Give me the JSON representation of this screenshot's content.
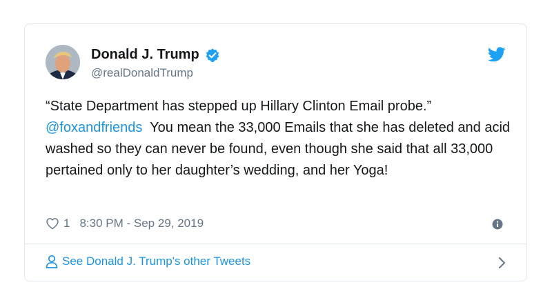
{
  "tweet": {
    "author_name": "Donald J. Trump",
    "handle": "@realDonaldTrump",
    "text_quote": "“State Department has stepped up Hillary Clinton Email probe.”",
    "mention": "@foxandfriends",
    "text_body": "You mean the 33,000 Emails that she has deleted and acid washed so they can never be found, even though she said that all 33,000 pertained only to her daughter’s wedding, and her Yoga!",
    "like_count": "1",
    "timestamp": "8:30 PM - Sep 29, 2019"
  },
  "footer": {
    "link_text": "See Donald J. Trump's other Tweets"
  },
  "icons": {
    "avatar": "profile-photo",
    "verified": "verified-badge-icon",
    "brand": "twitter-bird-icon",
    "like": "heart-icon",
    "info": "info-icon",
    "person": "person-icon",
    "chevron": "chevron-right-icon"
  },
  "colors": {
    "accent": "#1b95e0",
    "verified": "#1da1f2",
    "text": "#14171a",
    "secondary": "#657786",
    "border": "#e1e8ed"
  }
}
